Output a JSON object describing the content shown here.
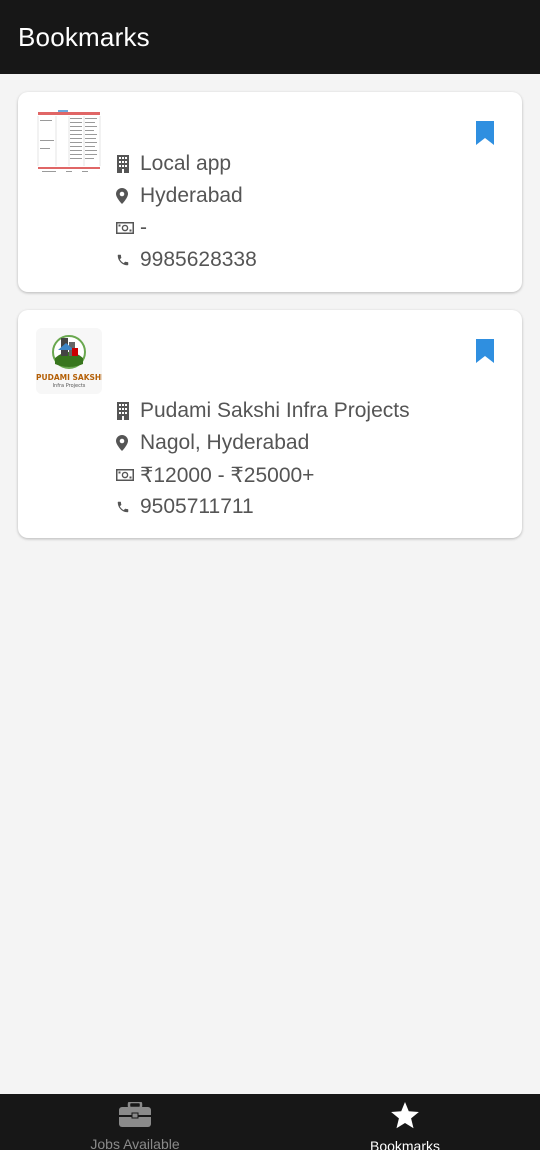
{
  "appbar": {
    "title": "Bookmarks"
  },
  "bookmarks": [
    {
      "company": "Local app",
      "location": "Hyderabad",
      "salary": "-",
      "phone": "9985628338",
      "thumbnail": "spreadsheet-thumbnail",
      "bookmarked": true
    },
    {
      "company": "Pudami Sakshi Infra Projects",
      "location": "Nagol, Hyderabad",
      "salary": "₹12000 - ₹25000+",
      "phone": "9505711711",
      "thumbnail": "pudami-sakshi-logo",
      "logo_text": "PUDAMI SAKSHI",
      "logo_subtext": "Infra Projects",
      "bookmarked": true
    }
  ],
  "bottom_nav": [
    {
      "label": "Jobs Available",
      "icon": "briefcase-icon",
      "active": false
    },
    {
      "label": "Bookmarks",
      "icon": "star-icon",
      "active": true
    }
  ],
  "colors": {
    "appbar_bg": "#171717",
    "accent_bookmark": "#2f8fe0",
    "text_secondary": "#555555",
    "background": "#f4f4f4"
  }
}
